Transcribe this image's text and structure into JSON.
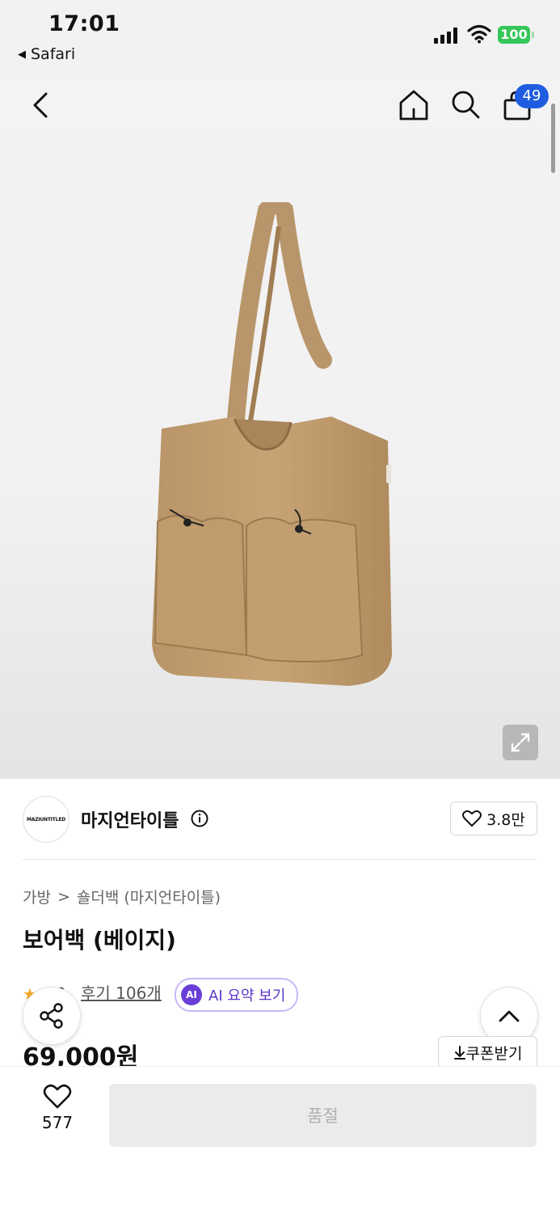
{
  "status_bar": {
    "time": "17:01",
    "back_app": "Safari",
    "battery": "100"
  },
  "header": {
    "cart_count": "49",
    "icons": [
      "back-icon",
      "home-icon",
      "search-icon",
      "shopping-bag-icon"
    ]
  },
  "brand": {
    "logo_text": "MAZIUNTITLED",
    "name": "마지언타이틀",
    "likes": "3.8만"
  },
  "breadcrumb": {
    "category": "가방",
    "separator": ">",
    "subcategory": "숄더백 (마지언타이틀)"
  },
  "product": {
    "title": "보어백 (베이지)",
    "rating": "4.9",
    "review_label": "후기 106개",
    "ai_badge": "AI",
    "ai_summary_label": "AI 요약 보기",
    "price": "69,000원",
    "coupon_label": "쿠폰받기"
  },
  "bottom": {
    "favorite_count": "577",
    "soldout_label": "품절"
  },
  "colors": {
    "accent": "#1f5ce0",
    "ai_purple": "#6a3fd8",
    "star": "#f5a623",
    "bag": "#c29e6e",
    "battery": "#34c759"
  }
}
